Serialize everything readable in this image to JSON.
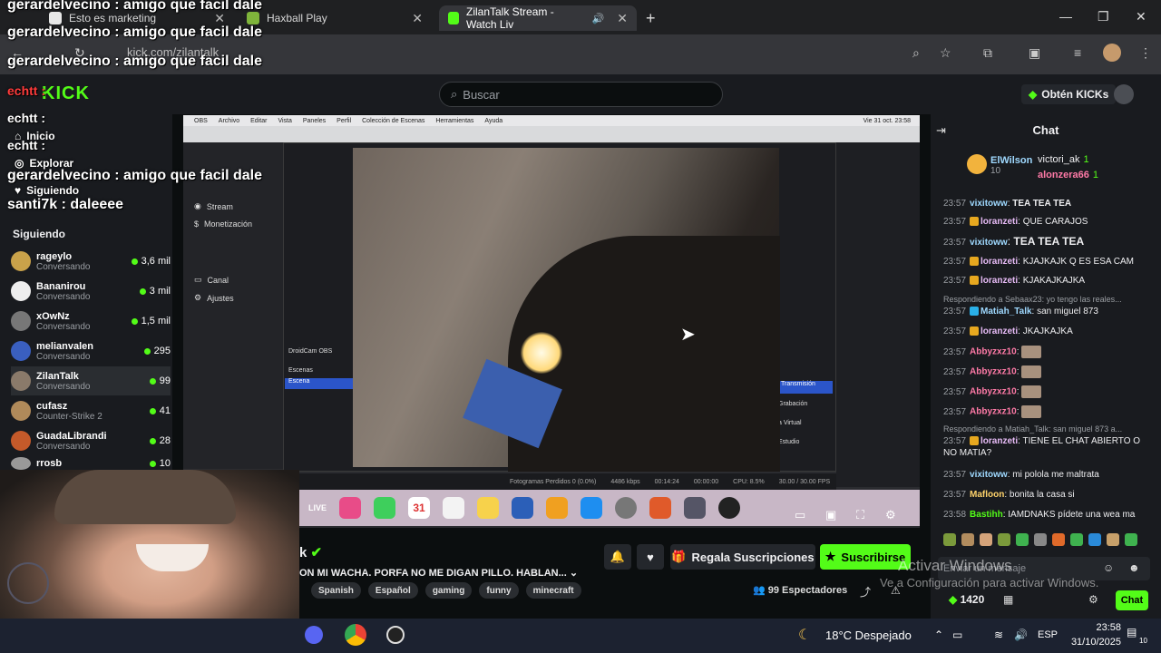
{
  "browser": {
    "tabs": [
      {
        "label": "Esto es marketing"
      },
      {
        "label": "Haxball Play"
      },
      {
        "label": "ZilanTalk Stream - Watch Liv"
      }
    ],
    "url": "kick.com/zilantalk"
  },
  "kick": {
    "logo": "KICK",
    "search_placeholder": "Buscar",
    "get_kicks": "Obtén KICKs",
    "nav": {
      "home": "Inicio",
      "explore": "Explorar",
      "following": "Siguiendo"
    },
    "following_title": "Siguiendo",
    "following": [
      {
        "name": "rageylo",
        "sub": "Conversando",
        "count": "3,6 mil"
      },
      {
        "name": "Bananirou",
        "sub": "Conversando",
        "count": "3 mil"
      },
      {
        "name": "xOwNz",
        "sub": "Conversando",
        "count": "1,5 mil"
      },
      {
        "name": "melianvalen",
        "sub": "Conversando",
        "count": "295"
      },
      {
        "name": "ZilanTalk",
        "sub": "Conversando",
        "count": "99"
      },
      {
        "name": "cufasz",
        "sub": "Counter-Strike 2",
        "count": "41"
      },
      {
        "name": "GuadaLibrandi",
        "sub": "Conversando",
        "count": "28"
      },
      {
        "name": "rrosb",
        "sub": "",
        "count": "10"
      }
    ]
  },
  "overlay": {
    "l1": "gerardelvecino : amigo que facil dale",
    "l2": "gerardelvecino : amigo que facil dale",
    "l3": "gerardelvecino : amigo que facil dale",
    "l4": "echtt :",
    "l5": "echtt :",
    "l6": "echtt :",
    "l7": "gerardelvecino : amigo que facil dale",
    "l8": "santi7k : daleeee"
  },
  "obs": {
    "menu": [
      "OBS",
      "Archivo",
      "Editar",
      "Vista",
      "Paneles",
      "Perfil",
      "Colección de Escenas",
      "Herramientas",
      "Ayuda"
    ],
    "clock": "Vie 31 oct. 23:58",
    "sidebar": [
      "Stream",
      "Monetización",
      "Canal",
      "Ajustes"
    ],
    "scenes_title": "Escenas",
    "scene": "Escena",
    "source": "DroidCam OBS",
    "status": {
      "dropped": "Fotogramas Perdidos 0 (0.0%)",
      "kbps": "4486 kbps",
      "time": "00:14:24",
      "time2": "00:00:00",
      "cpu": "CPU: 8.5%",
      "fps": "30.00 / 30.00 FPS"
    },
    "controls": [
      "Transmisión",
      "Grabación",
      "a Virtual",
      "Estudio"
    ],
    "dock_date": "31",
    "dock_live": "LIVE"
  },
  "stream": {
    "streamer": "k",
    "title": "ON MI WACHA. PORFA NO ME DIGAN PILLO. HABLAN...",
    "tags": [
      "Spanish",
      "Español",
      "gaming",
      "funny",
      "minecraft"
    ],
    "gift_label": "Regala Suscripciones",
    "subscribe_label": "Suscribirse",
    "viewers": "99 Espectadores"
  },
  "chat": {
    "title": "Chat",
    "leaders": [
      {
        "name": "ElWilson",
        "value": "10"
      },
      {
        "name": "victori_ak",
        "value": "1"
      },
      {
        "name": "alonzera66",
        "value": "1"
      }
    ],
    "messages": [
      {
        "time": "23:57",
        "user": "vixitoww",
        "text": "TEA TEA TEA"
      },
      {
        "time": "23:57",
        "user": "loranzeti",
        "text": "QUE CARAJOS"
      },
      {
        "time": "23:57",
        "user": "vixitoww",
        "text": "TEA TEA TEA"
      },
      {
        "time": "23:57",
        "user": "loranzeti",
        "text": "KJAJKAJK Q ES ESA CAM"
      },
      {
        "time": "23:57",
        "user": "loranzeti",
        "text": "KJAKAJKAJKA"
      },
      {
        "reply": "Respondiendo a Sebaax23: yo tengo las reales..."
      },
      {
        "time": "23:57",
        "user": "Matiah_Talk",
        "text": "san miguel 873"
      },
      {
        "time": "23:57",
        "user": "loranzeti",
        "text": "JKAJKAJKA"
      },
      {
        "time": "23:57",
        "user": "Abbyzxz10",
        "text": ""
      },
      {
        "time": "23:57",
        "user": "Abbyzxz10",
        "text": ""
      },
      {
        "time": "23:57",
        "user": "Abbyzxz10",
        "text": ""
      },
      {
        "time": "23:57",
        "user": "Abbyzxz10",
        "text": ""
      },
      {
        "reply": "Respondiendo a Matiah_Talk: san miguel 873 a..."
      },
      {
        "time": "23:57",
        "user": "loranzeti",
        "text": "TIENE EL CHAT ABIERTO O NO MATIA?"
      },
      {
        "time": "23:57",
        "user": "vixitoww",
        "text": "mi polola me maltrata"
      },
      {
        "time": "23:57",
        "user": "Mafloon",
        "text": "bonita la casa si"
      },
      {
        "time": "23:58",
        "user": "Bastihh",
        "text": "IAMDNAKS pídete una wea ma"
      }
    ],
    "input_placeholder": "Enviar un mensaje",
    "kicks_balance": "1420",
    "send_label": "Chat"
  },
  "windows": {
    "activate_title": "Activar Windows",
    "activate_sub": "Ve a Configuración para activar Windows.",
    "weather": "18°C Despejado",
    "lang": "ESP",
    "time": "23:58",
    "date": "31/10/2025",
    "notif": "10"
  },
  "colors": {
    "kick_green": "#53fc18",
    "bg": "#0b0e0f",
    "panel": "#191b1f"
  }
}
